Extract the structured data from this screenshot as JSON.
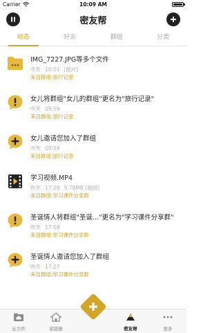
{
  "status_bar": {
    "carrier": "Carrier",
    "time": "10:09 AM"
  },
  "nav": {
    "title": "密友帮",
    "left_icon": "pause-icon",
    "right_icon": "plus-icon"
  },
  "tabs": [
    {
      "label": "动态",
      "active": true
    },
    {
      "label": "好友",
      "active": false
    },
    {
      "label": "群组",
      "active": false
    },
    {
      "label": "分类",
      "active": false
    }
  ],
  "feed": [
    {
      "icon": "folder-icon",
      "title": "IMG_7227.JPG等多个文件",
      "time": "今天",
      "time_value": "10:01",
      "meta": "[图片]",
      "source": "来自群组:旅行记录"
    },
    {
      "icon": "alert-icon",
      "title": "女儿将群组\"女儿的群组\"更名为\"旅行记录\"",
      "time": "今天",
      "time_value": "09:59",
      "meta": "",
      "source": "来自群组:旅行记录"
    },
    {
      "icon": "plus-icon",
      "title": "女儿邀请您加入了群组",
      "time": "今天",
      "time_value": "09:59",
      "meta": "",
      "source": "来自群组:旅行记录"
    },
    {
      "icon": "video-icon",
      "title": "学习视频.MP4",
      "time": "昨天",
      "time_value": "17:09",
      "meta": "9.79MB [视频]",
      "source": "来自群组:学习课件分享群"
    },
    {
      "icon": "alert-icon",
      "title": "圣诞情人将群组\"圣诞…\"更名为\"学习课件分享群\"",
      "time": "昨天",
      "time_value": "17:08",
      "meta": "",
      "source": "来自群组:学习课件分享群"
    },
    {
      "icon": "plus-icon",
      "title": "圣诞情人邀请您加入了群组",
      "time": "昨天",
      "time_value": "17:07",
      "meta": "",
      "source": "来自群组:学习课件分享群"
    }
  ],
  "tabbar": [
    {
      "label": "云文件",
      "icon": "cloud-file-icon",
      "active": false
    },
    {
      "label": "家庭圈",
      "icon": "home-circle-icon",
      "active": false
    },
    {
      "label": "",
      "icon": "add-icon",
      "active": false
    },
    {
      "label": "密友帮",
      "icon": "friends-icon",
      "active": true
    },
    {
      "label": "更多",
      "icon": "more-icon",
      "active": false
    }
  ],
  "colors": {
    "accent": "#d4a628",
    "icon_bg": "#e6b93c",
    "dark": "#222222"
  }
}
